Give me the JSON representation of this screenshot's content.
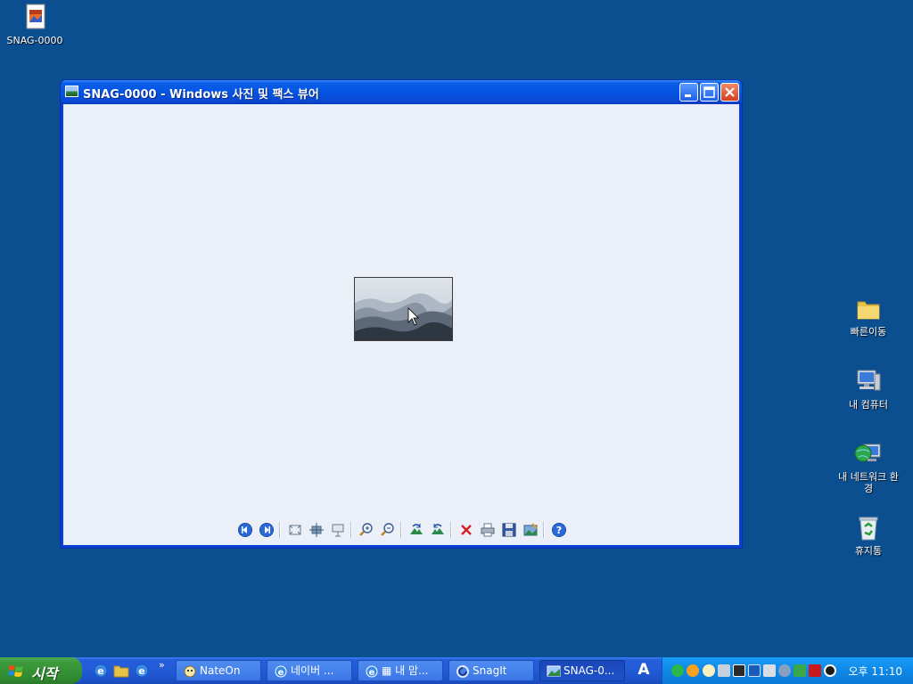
{
  "desktop": {
    "icons": [
      {
        "name": "SNAG-0000"
      },
      {
        "name": "빠른이동"
      },
      {
        "name": "내 컴퓨터"
      },
      {
        "name": "내 네트워크 환경"
      },
      {
        "name": "휴지통"
      }
    ]
  },
  "window": {
    "title": "SNAG-0000 - Windows 사진 및 팩스 뷰어",
    "toolbar_buttons": [
      "previous-image",
      "next-image",
      "best-fit",
      "actual-size",
      "slide-show",
      "zoom-in",
      "zoom-out",
      "rotate-clockwise",
      "rotate-counterclockwise",
      "delete",
      "print",
      "copy-to",
      "open-for-editing",
      "help"
    ]
  },
  "taskbar": {
    "start_label": "시작",
    "quick_launch": [
      "ie-icon",
      "folder-icon",
      "ie-icon"
    ],
    "tasks": [
      {
        "label": "NateOn",
        "active": false
      },
      {
        "label": "네이버 ...",
        "active": false
      },
      {
        "label": "▦ 내 맘...",
        "active": false
      },
      {
        "label": "SnagIt",
        "active": false
      },
      {
        "label": "SNAG-0...",
        "active": true
      }
    ],
    "language_indicator": "A",
    "clock": "오후 11:10"
  },
  "colors": {
    "desktop": "#0b4f91",
    "titlebar": "#0554e3",
    "client": "#ebf0f8",
    "taskbar": "#225bd6",
    "start": "#3c9a3c",
    "tray": "#0f88e8"
  }
}
